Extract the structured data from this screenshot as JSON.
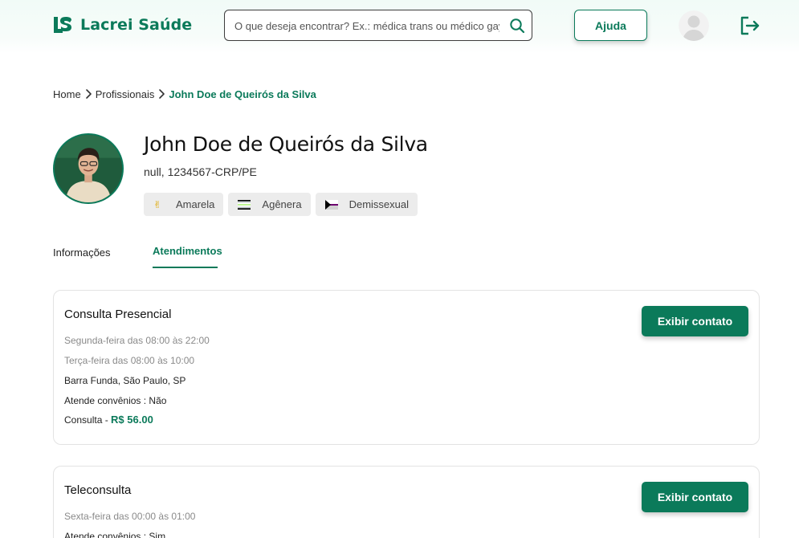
{
  "header": {
    "logo_text": "Lacrei Saúde",
    "search_placeholder": "O que deseja encontrar? Ex.: médica trans ou médico gay",
    "help_label": "Ajuda"
  },
  "breadcrumb": {
    "items": [
      "Home",
      "Profissionais"
    ],
    "current": "John Doe de Queirós da Silva"
  },
  "profile": {
    "name": "John Doe de Queirós da Silva",
    "registration": "null, 1234567-CRP/PE",
    "tags": [
      {
        "label": "Amarela",
        "icon": "peace-hand-icon"
      },
      {
        "label": "Agênera",
        "icon": "agender-flag-icon"
      },
      {
        "label": "Demissexual",
        "icon": "demisexual-flag-icon"
      }
    ]
  },
  "tabs": [
    "Informações",
    "Atendimentos"
  ],
  "active_tab": "Atendimentos",
  "services": [
    {
      "title": "Consulta Presencial",
      "schedule": [
        "Segunda-feira das 08:00 às 22:00",
        "Terça-feira das 08:00 às 10:00"
      ],
      "location": "Barra Funda, São Paulo, SP",
      "insurance": "Atende convênios : Não",
      "price_label": "Consulta - ",
      "price_value": "R$ 56.00",
      "button_label": "Exibir contato"
    },
    {
      "title": "Teleconsulta",
      "schedule": [
        "Sexta-feira das 00:00 às 01:00"
      ],
      "insurance": "Atende convênios : Sim",
      "button_label": "Exibir contato"
    }
  ],
  "colors": {
    "accent": "#0b7a5a",
    "muted_text": "#8a8a8a",
    "tag_bg": "#ececec"
  }
}
